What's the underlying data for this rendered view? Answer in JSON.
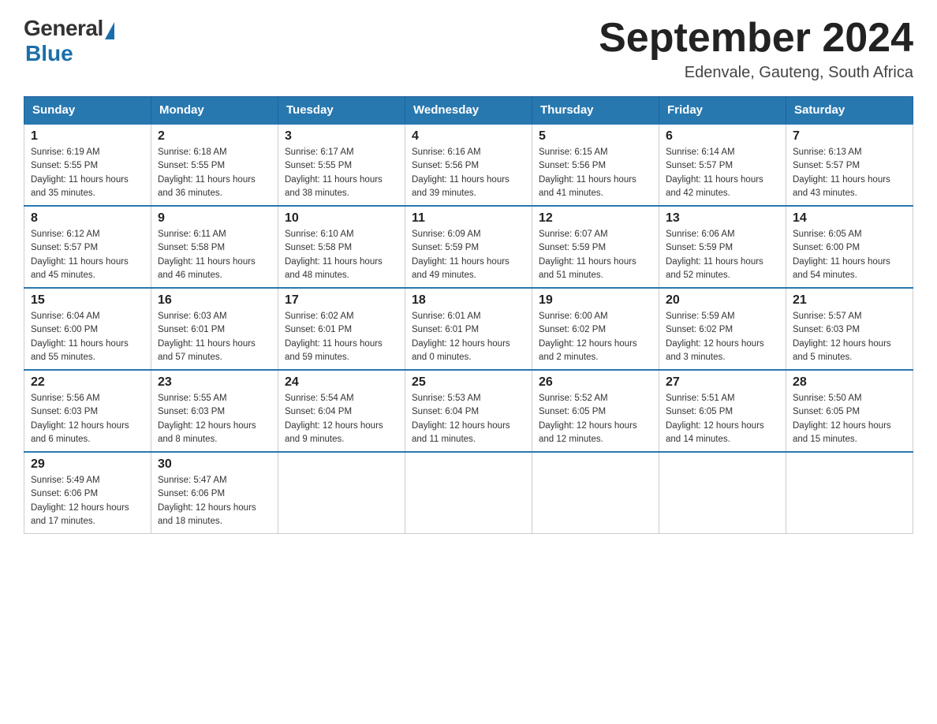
{
  "header": {
    "logo_general": "General",
    "logo_blue": "Blue",
    "month_title": "September 2024",
    "location": "Edenvale, Gauteng, South Africa"
  },
  "days_of_week": [
    "Sunday",
    "Monday",
    "Tuesday",
    "Wednesday",
    "Thursday",
    "Friday",
    "Saturday"
  ],
  "weeks": [
    [
      {
        "day": "1",
        "sunrise": "6:19 AM",
        "sunset": "5:55 PM",
        "daylight": "11 hours and 35 minutes."
      },
      {
        "day": "2",
        "sunrise": "6:18 AM",
        "sunset": "5:55 PM",
        "daylight": "11 hours and 36 minutes."
      },
      {
        "day": "3",
        "sunrise": "6:17 AM",
        "sunset": "5:55 PM",
        "daylight": "11 hours and 38 minutes."
      },
      {
        "day": "4",
        "sunrise": "6:16 AM",
        "sunset": "5:56 PM",
        "daylight": "11 hours and 39 minutes."
      },
      {
        "day": "5",
        "sunrise": "6:15 AM",
        "sunset": "5:56 PM",
        "daylight": "11 hours and 41 minutes."
      },
      {
        "day": "6",
        "sunrise": "6:14 AM",
        "sunset": "5:57 PM",
        "daylight": "11 hours and 42 minutes."
      },
      {
        "day": "7",
        "sunrise": "6:13 AM",
        "sunset": "5:57 PM",
        "daylight": "11 hours and 43 minutes."
      }
    ],
    [
      {
        "day": "8",
        "sunrise": "6:12 AM",
        "sunset": "5:57 PM",
        "daylight": "11 hours and 45 minutes."
      },
      {
        "day": "9",
        "sunrise": "6:11 AM",
        "sunset": "5:58 PM",
        "daylight": "11 hours and 46 minutes."
      },
      {
        "day": "10",
        "sunrise": "6:10 AM",
        "sunset": "5:58 PM",
        "daylight": "11 hours and 48 minutes."
      },
      {
        "day": "11",
        "sunrise": "6:09 AM",
        "sunset": "5:59 PM",
        "daylight": "11 hours and 49 minutes."
      },
      {
        "day": "12",
        "sunrise": "6:07 AM",
        "sunset": "5:59 PM",
        "daylight": "11 hours and 51 minutes."
      },
      {
        "day": "13",
        "sunrise": "6:06 AM",
        "sunset": "5:59 PM",
        "daylight": "11 hours and 52 minutes."
      },
      {
        "day": "14",
        "sunrise": "6:05 AM",
        "sunset": "6:00 PM",
        "daylight": "11 hours and 54 minutes."
      }
    ],
    [
      {
        "day": "15",
        "sunrise": "6:04 AM",
        "sunset": "6:00 PM",
        "daylight": "11 hours and 55 minutes."
      },
      {
        "day": "16",
        "sunrise": "6:03 AM",
        "sunset": "6:01 PM",
        "daylight": "11 hours and 57 minutes."
      },
      {
        "day": "17",
        "sunrise": "6:02 AM",
        "sunset": "6:01 PM",
        "daylight": "11 hours and 59 minutes."
      },
      {
        "day": "18",
        "sunrise": "6:01 AM",
        "sunset": "6:01 PM",
        "daylight": "12 hours and 0 minutes."
      },
      {
        "day": "19",
        "sunrise": "6:00 AM",
        "sunset": "6:02 PM",
        "daylight": "12 hours and 2 minutes."
      },
      {
        "day": "20",
        "sunrise": "5:59 AM",
        "sunset": "6:02 PM",
        "daylight": "12 hours and 3 minutes."
      },
      {
        "day": "21",
        "sunrise": "5:57 AM",
        "sunset": "6:03 PM",
        "daylight": "12 hours and 5 minutes."
      }
    ],
    [
      {
        "day": "22",
        "sunrise": "5:56 AM",
        "sunset": "6:03 PM",
        "daylight": "12 hours and 6 minutes."
      },
      {
        "day": "23",
        "sunrise": "5:55 AM",
        "sunset": "6:03 PM",
        "daylight": "12 hours and 8 minutes."
      },
      {
        "day": "24",
        "sunrise": "5:54 AM",
        "sunset": "6:04 PM",
        "daylight": "12 hours and 9 minutes."
      },
      {
        "day": "25",
        "sunrise": "5:53 AM",
        "sunset": "6:04 PM",
        "daylight": "12 hours and 11 minutes."
      },
      {
        "day": "26",
        "sunrise": "5:52 AM",
        "sunset": "6:05 PM",
        "daylight": "12 hours and 12 minutes."
      },
      {
        "day": "27",
        "sunrise": "5:51 AM",
        "sunset": "6:05 PM",
        "daylight": "12 hours and 14 minutes."
      },
      {
        "day": "28",
        "sunrise": "5:50 AM",
        "sunset": "6:05 PM",
        "daylight": "12 hours and 15 minutes."
      }
    ],
    [
      {
        "day": "29",
        "sunrise": "5:49 AM",
        "sunset": "6:06 PM",
        "daylight": "12 hours and 17 minutes."
      },
      {
        "day": "30",
        "sunrise": "5:47 AM",
        "sunset": "6:06 PM",
        "daylight": "12 hours and 18 minutes."
      },
      null,
      null,
      null,
      null,
      null
    ]
  ],
  "labels": {
    "sunrise": "Sunrise:",
    "sunset": "Sunset:",
    "daylight": "Daylight:"
  }
}
